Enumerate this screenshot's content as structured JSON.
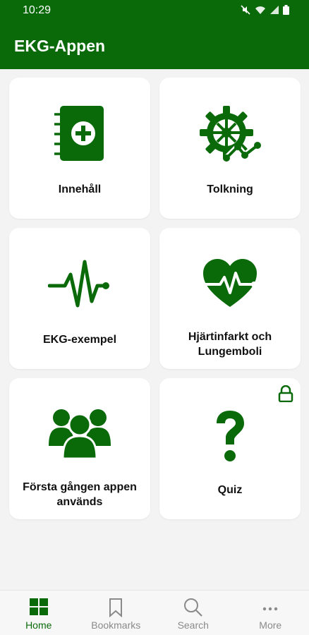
{
  "status": {
    "time": "10:29"
  },
  "app": {
    "title": "EKG-Appen"
  },
  "cards": [
    {
      "label": "Innehåll"
    },
    {
      "label": "Tolkning"
    },
    {
      "label": "EKG-exempel"
    },
    {
      "label": "Hjärtinfarkt och Lungemboli"
    },
    {
      "label": "Första gången appen används"
    },
    {
      "label": "Quiz"
    }
  ],
  "nav": {
    "home": "Home",
    "bookmarks": "Bookmarks",
    "search": "Search",
    "more": "More"
  },
  "colors": {
    "primary": "#0a6a0a",
    "background": "#f3f3f3",
    "inactive": "#8a8a8a"
  },
  "icons": [
    "mute-icon",
    "wifi-icon",
    "signal-icon",
    "battery-icon",
    "book-plus-icon",
    "gear-chart-icon",
    "ecg-wave-icon",
    "heart-pulse-icon",
    "users-icon",
    "question-icon",
    "lock-icon",
    "grid-icon",
    "bookmark-icon",
    "search-icon",
    "more-icon"
  ]
}
